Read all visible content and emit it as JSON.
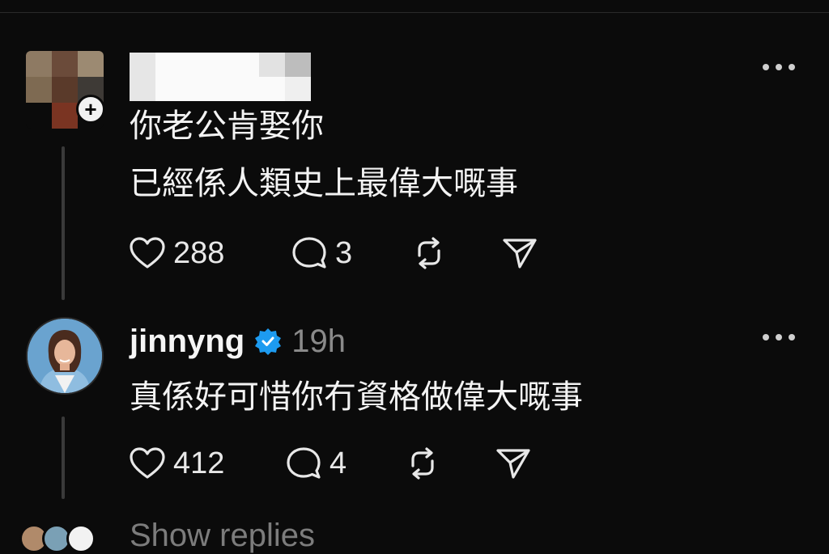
{
  "comments": [
    {
      "username": "",
      "username_redacted": true,
      "lines": [
        "你老公肯娶你",
        "已經係人類史上最偉大嘅事"
      ],
      "likes": "288",
      "replies": "3",
      "follow_symbol": "+"
    },
    {
      "username": "jinnyng",
      "verified": true,
      "time": "19h",
      "text": "真係好可惜你冇資格做偉大嘅事",
      "likes": "412",
      "replies": "4"
    }
  ],
  "footer": {
    "show_replies": "Show replies"
  },
  "icons": [
    "heart-icon",
    "comment-icon",
    "repost-icon",
    "share-icon",
    "more-icon",
    "verified-badge-icon",
    "follow-plus-icon"
  ],
  "colors": {
    "background": "#0b0b0b",
    "text": "#f3f3f3",
    "muted": "#8a8a8a",
    "verified": "#1d9bf0"
  }
}
